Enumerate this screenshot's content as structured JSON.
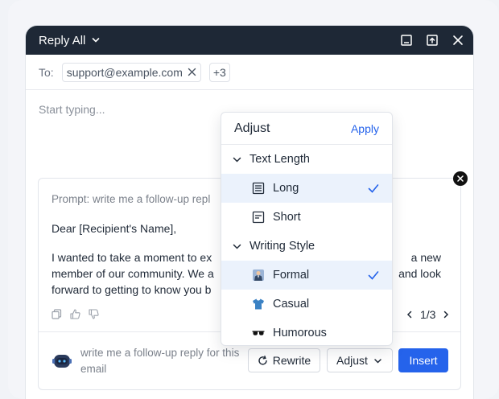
{
  "header": {
    "title": "Reply All"
  },
  "recipients": {
    "to_label": "To:",
    "chip_email": "support@example.com",
    "more_count": "+3"
  },
  "compose": {
    "placeholder": "Start typing..."
  },
  "ai_panel": {
    "prompt_line": "Prompt: write me a follow-up repl",
    "greeting": "Dear [Recipient's Name],",
    "body_lines": [
      {
        "left": "I wanted to take a moment to ex",
        "right": "a new"
      },
      {
        "left": "member of our community. We a",
        "right": "and look"
      },
      {
        "left": "forward to getting to know you b",
        "right": ""
      }
    ],
    "pager": "1/3",
    "followup_text": "write me a follow-up reply for this email",
    "rewrite_label": "Rewrite",
    "adjust_label": "Adjust",
    "insert_label": "Insert"
  },
  "adjust_menu": {
    "title": "Adjust",
    "apply_label": "Apply",
    "sections": [
      {
        "label": "Text Length",
        "items": [
          {
            "label": "Long",
            "icon": "long-text-icon",
            "selected": true
          },
          {
            "label": "Short",
            "icon": "short-text-icon",
            "selected": false
          }
        ]
      },
      {
        "label": "Writing Style",
        "items": [
          {
            "label": "Formal",
            "icon": "suit-person-icon",
            "selected": true
          },
          {
            "label": "Casual",
            "icon": "t-shirt-icon",
            "selected": false
          },
          {
            "label": "Humorous",
            "icon": "sunglasses-icon",
            "selected": false
          }
        ]
      }
    ]
  },
  "colors": {
    "titlebar": "#1e2836",
    "accent": "#2563eb",
    "selected_row": "#ebf2fc"
  }
}
